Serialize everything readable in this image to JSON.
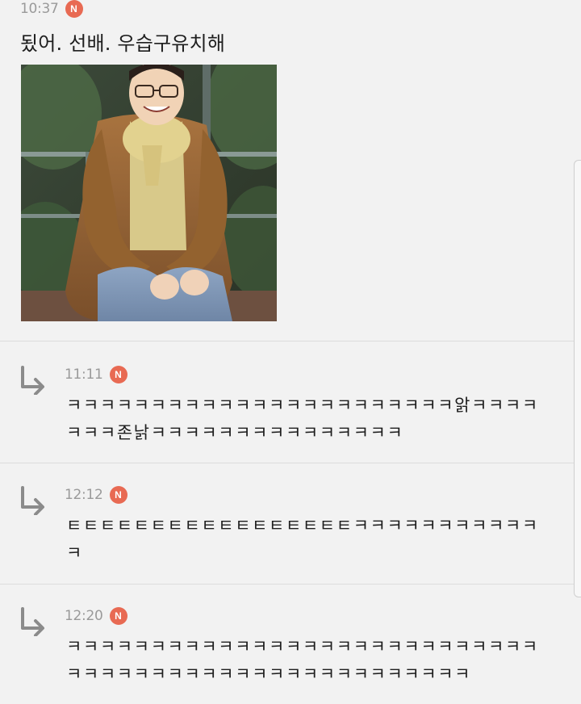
{
  "post": {
    "time": "10:37",
    "badge": "N",
    "text": "됬어. 선배. 우습구유치해"
  },
  "replies": [
    {
      "time": "11:11",
      "badge": "N",
      "text": "ㅋㅋㅋㅋㅋㅋㅋㅋㅋㅋㅋㅋㅋㅋㅋㅋㅋㅋㅋㅋㅋㅋㅋ앍ㅋㅋㅋㅋㅋㅋㅋ존낡ㅋㅋㅋㅋㅋㅋㅋㅋㅋㅋㅋㅋㅋㅋㅋ"
    },
    {
      "time": "12:12",
      "badge": "N",
      "text": "ㅌㅌㅌㅌㅌㅌㅌㅌㅌㅌㅌㅌㅌㅌㅌㅌㅌㅋㅋㅋㅋㅋㅋㅋㅋㅋㅋㅋㅋ"
    },
    {
      "time": "12:20",
      "badge": "N",
      "text": "ㅋㅋㅋㅋㅋㅋㅋㅋㅋㅋㅋㅋㅋㅋㅋㅋㅋㅋㅋㅋㅋㅋㅋㅋㅋㅋㅋㅋㅋㅋㅋㅋㅋㅋㅋㅋㅋㅋㅋㅋㅋㅋㅋㅋㅋㅋㅋㅋㅋㅋㅋㅋ"
    }
  ],
  "colors": {
    "background": "#f2f2f2",
    "badge": "#e86a53",
    "time": "#9a9a9a",
    "divider": "#dcdcdc"
  },
  "icons": {
    "badge": "new-badge-icon",
    "reply": "reply-arrow-icon"
  }
}
